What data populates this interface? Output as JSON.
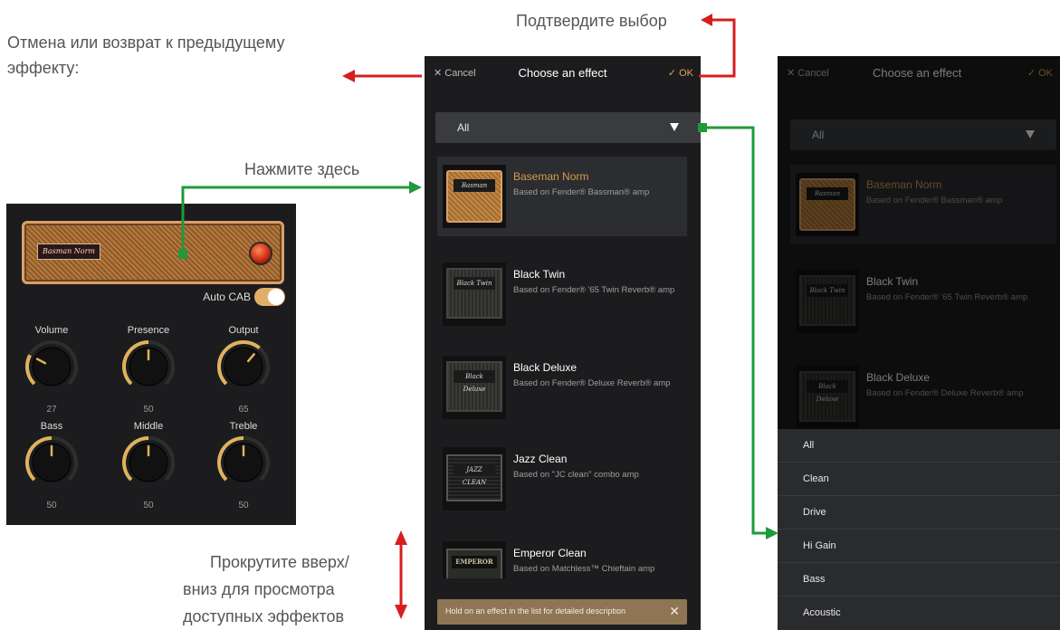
{
  "annotations": {
    "confirm": "Подтвердите выбор",
    "cancel_back": "Отмена или возврат к предыдущему эффекту:",
    "cancel_back_line1": "Отмена или возврат к предыдущему",
    "cancel_back_line2": "эффекту:",
    "tap_here": "Нажмите здесь",
    "scroll_line1": "Прокрутите вверх/",
    "scroll_line2": "вниз для просмотра",
    "scroll_line3": "доступных эффектов"
  },
  "amp_panel": {
    "badge": "Basman Norm",
    "auto_cab_label": "Auto CAB",
    "auto_cab_on": true,
    "knobs": [
      {
        "label": "Volume",
        "value": "27",
        "level": 0.27
      },
      {
        "label": "Presence",
        "value": "50",
        "level": 0.5
      },
      {
        "label": "Output",
        "value": "65",
        "level": 0.65
      },
      {
        "label": "Bass",
        "value": "50",
        "level": 0.5
      },
      {
        "label": "Middle",
        "value": "50",
        "level": 0.5
      },
      {
        "label": "Treble",
        "value": "50",
        "level": 0.5
      }
    ]
  },
  "chooser": {
    "cancel_label": "Cancel",
    "title": "Choose an effect",
    "ok_label": "OK",
    "filter_value": "All",
    "effects": [
      {
        "name": "Baseman Norm",
        "desc": "Based on Fender® Bassman® amp",
        "plate": "Basman"
      },
      {
        "name": "Black Twin",
        "desc": "Based on Fender® '65 Twin Reverb® amp",
        "plate": "Black Twin"
      },
      {
        "name": "Black Deluxe",
        "desc": "Based on Fender® Deluxe Reverb® amp",
        "plate": "Black Deluxe"
      },
      {
        "name": "Jazz Clean",
        "desc": "Based on \"JC clean\" combo amp",
        "plate": "JAZZ CLEAN"
      },
      {
        "name": "Emperor Clean",
        "desc": "Based on Matchless™ Chieftain amp",
        "plate": "EMPEROR"
      }
    ],
    "hint": "Hold on an effect in the list for detailed description",
    "dropdown_options": [
      "All",
      "Clean",
      "Drive",
      "Hi Gain",
      "Bass",
      "Acoustic"
    ]
  },
  "colors": {
    "accent": "#d9a84c",
    "arrow_red": "#d41f1f",
    "arrow_green": "#1f9a3a"
  }
}
